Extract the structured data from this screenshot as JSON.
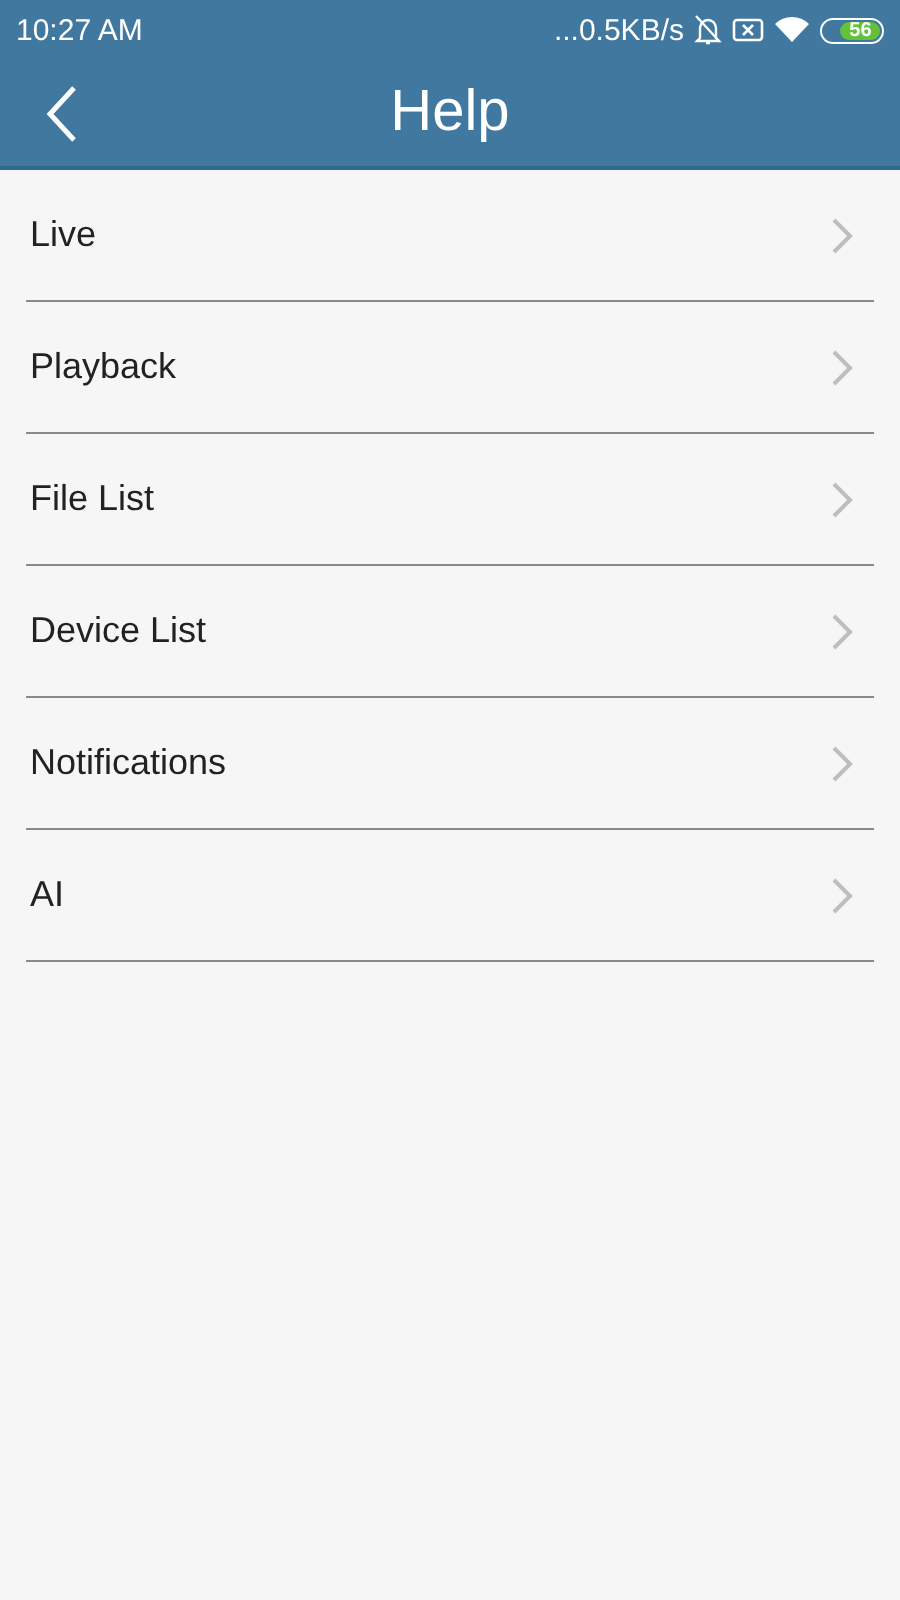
{
  "status_bar": {
    "time": "10:27  AM",
    "network_speed": "...0.5KB/s",
    "battery": "56"
  },
  "header": {
    "title": "Help"
  },
  "items": [
    {
      "label": "Live"
    },
    {
      "label": "Playback"
    },
    {
      "label": "File List"
    },
    {
      "label": "Device List"
    },
    {
      "label": "Notifications"
    },
    {
      "label": "AI"
    }
  ]
}
